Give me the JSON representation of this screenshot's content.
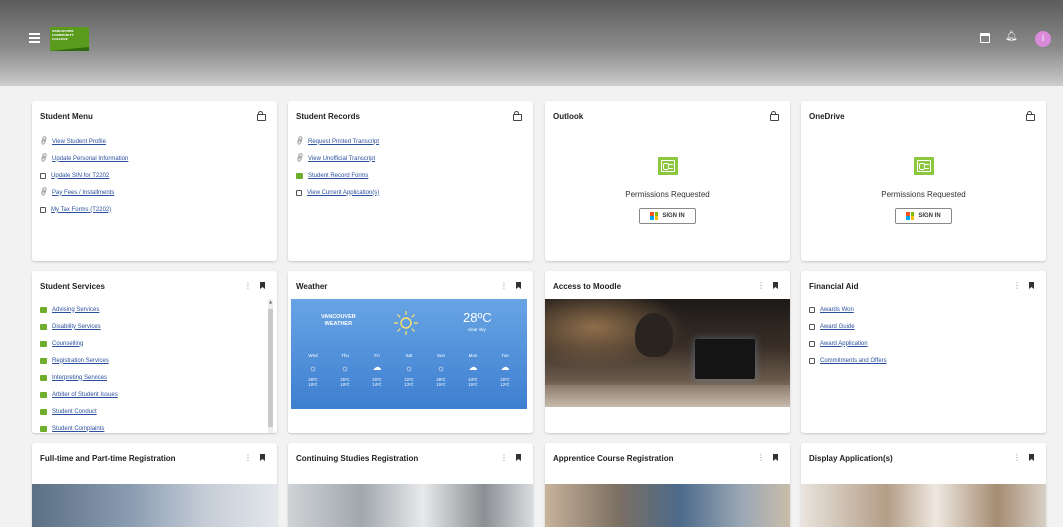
{
  "header": {
    "logo_lines": [
      "VANCOUVER",
      "COMMUNITY",
      "COLLEGE"
    ],
    "avatar_initial": "I"
  },
  "cards": {
    "student_menu": {
      "title": "Student Menu",
      "items": [
        {
          "label": "View Student Profile",
          "icon": "link-icon"
        },
        {
          "label": "Update Personal Information",
          "icon": "link-icon"
        },
        {
          "label": "Update SIN for T2202",
          "icon": "document-icon"
        },
        {
          "label": "Pay Fees / Installments",
          "icon": "link-icon"
        },
        {
          "label": "My Tax Forms (T2202)",
          "icon": "document-icon"
        }
      ]
    },
    "student_records": {
      "title": "Student Records",
      "items": [
        {
          "label": "Request Printed Transcript",
          "icon": "link-icon"
        },
        {
          "label": "View Unofficial Transcript",
          "icon": "link-icon"
        },
        {
          "label": "Student Record Forms",
          "icon": "green-folder-icon"
        },
        {
          "label": "View Current Application(s)",
          "icon": "document-icon"
        }
      ]
    },
    "outlook": {
      "title": "Outlook",
      "message": "Permissions Requested",
      "signin_label": "SIGN IN"
    },
    "onedrive": {
      "title": "OneDrive",
      "message": "Permissions Requested",
      "signin_label": "SIGN IN"
    },
    "student_services": {
      "title": "Student Services",
      "items": [
        {
          "label": "Advising Services"
        },
        {
          "label": "Disability Services"
        },
        {
          "label": "Counselling"
        },
        {
          "label": "Registration Services"
        },
        {
          "label": "Interpreting Services"
        },
        {
          "label": "Arbiter of Student Issues"
        },
        {
          "label": "Student Conduct"
        },
        {
          "label": "Student Complaints"
        }
      ]
    },
    "weather": {
      "title": "Weather",
      "city_line1": "VANCOUVER",
      "city_line2": "WEATHER",
      "temperature": "28ºC",
      "description": "clear sky",
      "days": [
        {
          "day": "Wed",
          "icon": "sun-icon",
          "hi": "28ºC",
          "lo": "18ºC"
        },
        {
          "day": "Thu",
          "icon": "sun-icon",
          "hi": "25ºC",
          "lo": "18ºC"
        },
        {
          "day": "Fri",
          "icon": "cloud-icon",
          "hi": "20ºC",
          "lo": "14ºC"
        },
        {
          "day": "Sat",
          "icon": "sun-icon",
          "hi": "22ºC",
          "lo": "13ºC"
        },
        {
          "day": "Sun",
          "icon": "sun-icon",
          "hi": "26ºC",
          "lo": "15ºC"
        },
        {
          "day": "Mon",
          "icon": "cloud-icon",
          "hi": "24ºC",
          "lo": "16ºC"
        },
        {
          "day": "Tue",
          "icon": "cloud-icon",
          "hi": "20ºC",
          "lo": "12ºC"
        }
      ]
    },
    "moodle": {
      "title": "Access to Moodle"
    },
    "financial_aid": {
      "title": "Financial Aid",
      "items": [
        {
          "label": "Awards Won"
        },
        {
          "label": "Award Guide"
        },
        {
          "label": "Award Application"
        },
        {
          "label": "Commitments and Offers"
        }
      ]
    },
    "fulltime": {
      "title": "Full-time and Part-time Registration"
    },
    "continuing": {
      "title": "Continuing Studies Registration"
    },
    "apprentice": {
      "title": "Apprentice Course Registration"
    },
    "display_app": {
      "title": "Display Application(s)"
    }
  },
  "colors": {
    "accent_green": "#6fae2c",
    "link_blue": "#2a4f9e",
    "weather_blue": "#3d7fd0"
  }
}
